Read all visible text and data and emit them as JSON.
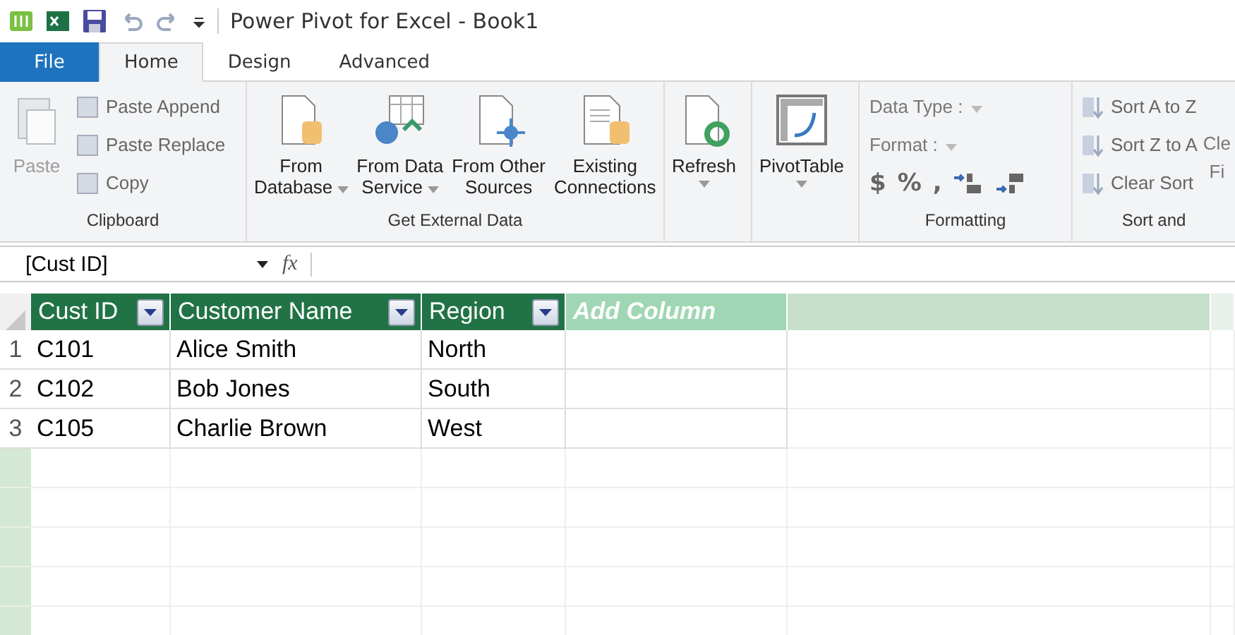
{
  "window": {
    "title": "Power Pivot for Excel - Book1"
  },
  "tabs": [
    {
      "label": "File",
      "kind": "file",
      "selected": false
    },
    {
      "label": "Home",
      "kind": "tab",
      "selected": true
    },
    {
      "label": "Design",
      "kind": "tab",
      "selected": false
    },
    {
      "label": "Advanced",
      "kind": "tab",
      "selected": false
    }
  ],
  "ribbon": {
    "groups": [
      {
        "label": "Clipboard",
        "items": [
          {
            "kind": "large",
            "label": "Paste",
            "disabled": true
          },
          {
            "kind": "small",
            "label": "Paste Append",
            "disabled": true
          },
          {
            "kind": "small",
            "label": "Paste Replace",
            "disabled": true
          },
          {
            "kind": "small",
            "label": "Copy",
            "disabled": true
          }
        ]
      },
      {
        "label": "Get External Data",
        "items": [
          {
            "kind": "large",
            "label": "From Database",
            "dropdown": true,
            "disabled": false
          },
          {
            "kind": "large",
            "label": "From Data Service",
            "dropdown": true,
            "disabled": false
          },
          {
            "kind": "large",
            "label": "From Other Sources",
            "dropdown": false,
            "disabled": false
          },
          {
            "kind": "large",
            "label": "Existing Connections",
            "dropdown": false,
            "disabled": false
          }
        ]
      },
      {
        "items": [
          {
            "kind": "large",
            "label": "Refresh",
            "dropdown": true,
            "disabled": false
          }
        ]
      },
      {
        "items": [
          {
            "kind": "large",
            "label": "PivotTable",
            "dropdown": true,
            "disabled": false
          }
        ]
      },
      {
        "label": "Formatting",
        "items": [
          {
            "kind": "select",
            "label": "Data Type :",
            "disabled": true
          },
          {
            "kind": "select",
            "label": "Format :",
            "disabled": true
          },
          {
            "kind": "symbols",
            "symbols": [
              "$",
              "%",
              ","
            ],
            "disabled": true
          }
        ]
      },
      {
        "label": "Sort and",
        "items": [
          {
            "kind": "small",
            "label": "Sort A to Z",
            "disabled": true
          },
          {
            "kind": "small",
            "label": "Sort Z to A",
            "disabled": true
          },
          {
            "kind": "small",
            "label": "Clear Sort",
            "disabled": true
          },
          {
            "kind": "cut",
            "label": "Cle",
            "label2": "Fi",
            "disabled": true
          }
        ]
      }
    ]
  },
  "formula_bar": {
    "name_box": "[Cust ID]",
    "fx": "fx"
  },
  "table": {
    "columns": [
      {
        "label": "Cust ID",
        "kind": "column"
      },
      {
        "label": "Customer Name",
        "kind": "column"
      },
      {
        "label": "Region",
        "kind": "column"
      },
      {
        "label": "Add Column",
        "kind": "add"
      }
    ],
    "rows": [
      {
        "number": "1",
        "cells": [
          "C101",
          "Alice Smith",
          "North"
        ]
      },
      {
        "number": "2",
        "cells": [
          "C102",
          "Bob Jones",
          "South"
        ]
      },
      {
        "number": "3",
        "cells": [
          "C105",
          "Charlie Brown",
          "West"
        ]
      }
    ]
  }
}
